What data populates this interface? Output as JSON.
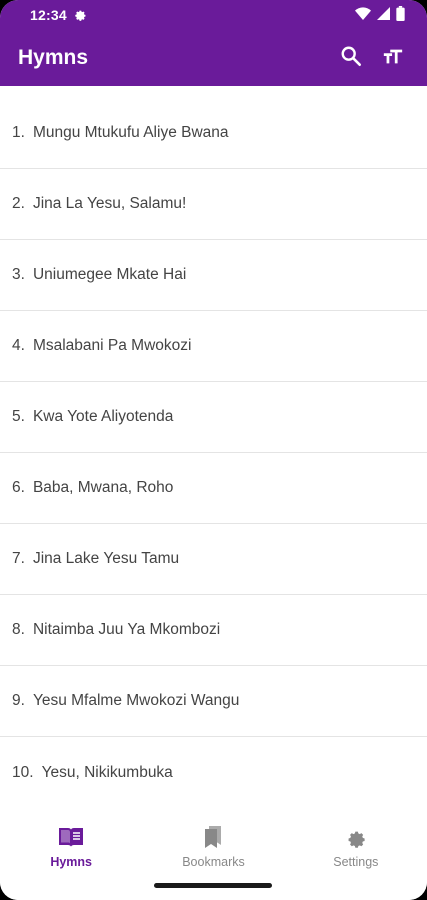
{
  "status_bar": {
    "time": "12:34"
  },
  "app_bar": {
    "title": "Hymns",
    "actions": [
      "search-icon",
      "text-size-icon"
    ]
  },
  "hymns": [
    {
      "number": "1.",
      "title": "Mungu Mtukufu Aliye Bwana"
    },
    {
      "number": "2.",
      "title": "Jina La Yesu, Salamu!"
    },
    {
      "number": "3.",
      "title": "Uniumegee Mkate Hai"
    },
    {
      "number": "4.",
      "title": "Msalabani Pa Mwokozi"
    },
    {
      "number": "5.",
      "title": "Kwa Yote Aliyotenda"
    },
    {
      "number": "6.",
      "title": "Baba, Mwana, Roho"
    },
    {
      "number": "7.",
      "title": "Jina Lake Yesu Tamu"
    },
    {
      "number": "8.",
      "title": "Nitaimba Juu Ya Mkombozi"
    },
    {
      "number": "9.",
      "title": "Yesu Mfalme Mwokozi Wangu"
    },
    {
      "number": "10.",
      "title": "Yesu, Nikikumbuka"
    }
  ],
  "bottom_nav": {
    "items": [
      {
        "label": "Hymns",
        "icon": "book-open-icon",
        "active": true
      },
      {
        "label": "Bookmarks",
        "icon": "bookmarks-icon",
        "active": false
      },
      {
        "label": "Settings",
        "icon": "gear-icon",
        "active": false
      }
    ]
  },
  "colors": {
    "primary": "#6a1b9a",
    "text": "#444444",
    "inactive": "#888888",
    "divider": "#e4e4e4"
  }
}
